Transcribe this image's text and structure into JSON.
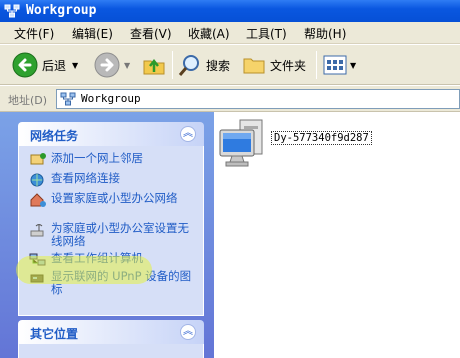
{
  "window": {
    "title": "Workgroup"
  },
  "menubar": {
    "items": [
      {
        "label": "文件(F)"
      },
      {
        "label": "编辑(E)"
      },
      {
        "label": "查看(V)"
      },
      {
        "label": "收藏(A)"
      },
      {
        "label": "工具(T)"
      },
      {
        "label": "帮助(H)"
      }
    ]
  },
  "toolbar": {
    "back_label": "后退",
    "search_label": "搜索",
    "folders_label": "文件夹"
  },
  "address": {
    "label": "地址(D)",
    "value": "Workgroup"
  },
  "network_tasks": {
    "title": "网络任务",
    "items": [
      {
        "label": "添加一个网上邻居"
      },
      {
        "label": "查看网络连接"
      },
      {
        "label": "设置家庭或小型办公网络"
      },
      {
        "label": "为家庭或小型办公室设置无线网络"
      },
      {
        "label": "查看工作组计算机"
      },
      {
        "label": "显示联网的 UPnP 设备的图标"
      }
    ]
  },
  "other_places": {
    "title": "其它位置"
  },
  "content": {
    "computer_name": "Dy-577340f9d287"
  },
  "colors": {
    "titlebar": "#0a57e0",
    "taskpane": "#6f8ee0",
    "task_link": "#215dc6",
    "highlight": "#e6f046"
  }
}
